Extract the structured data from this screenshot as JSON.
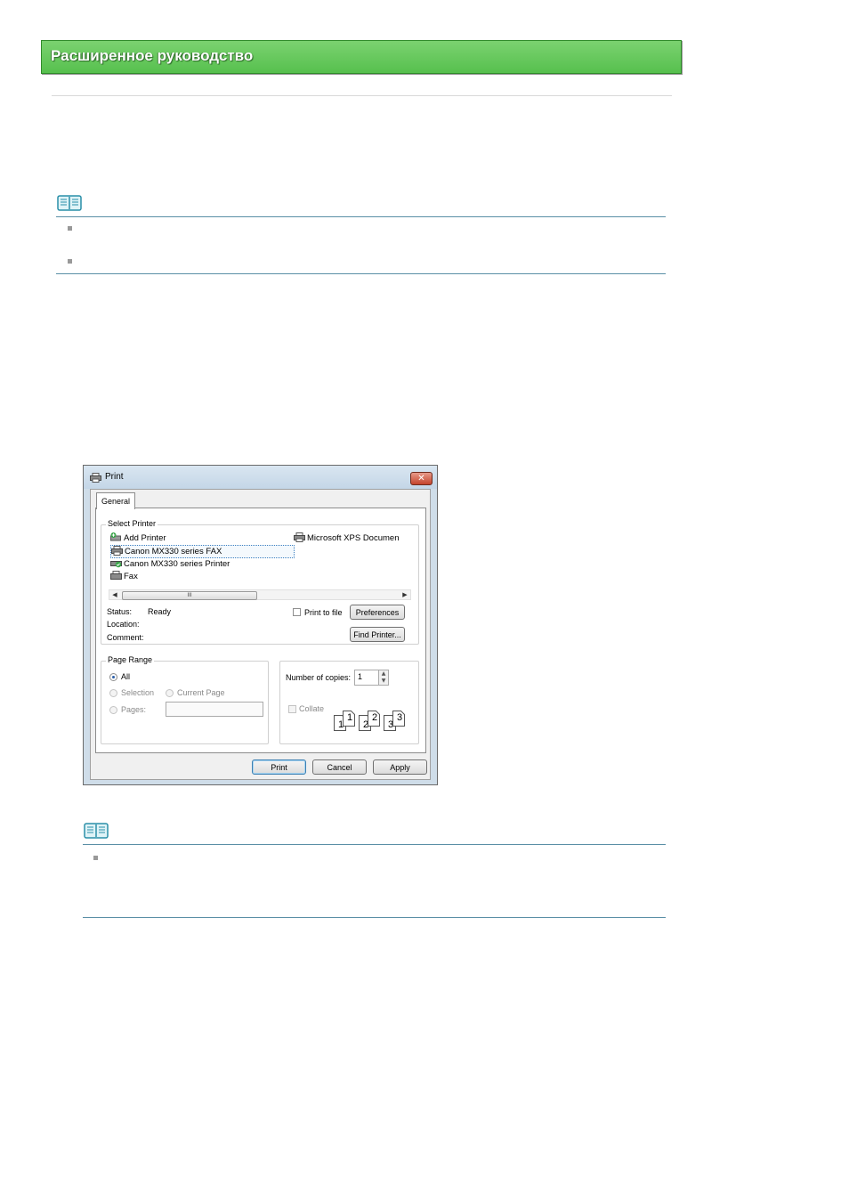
{
  "header": {
    "title": "Расширенное руководство"
  },
  "dialog": {
    "title": "Print",
    "close_label": "✕",
    "tab_general": "General",
    "select_printer": {
      "label": "Select Printer",
      "printers": [
        "Add Printer",
        "Canon MX330 series FAX",
        "Canon MX330 series Printer",
        "Fax",
        "Microsoft XPS Documen"
      ],
      "scroll_thumb": "III",
      "status_label": "Status:",
      "status_value": "Ready",
      "location_label": "Location:",
      "comment_label": "Comment:",
      "print_to_file": "Print to file",
      "preferences": "Preferences",
      "find_printer": "Find Printer..."
    },
    "page_range": {
      "label": "Page Range",
      "all": "All",
      "selection": "Selection",
      "current_page": "Current Page",
      "pages": "Pages:"
    },
    "copies": {
      "label": "Number of copies:",
      "value": "1",
      "collate": "Collate",
      "page_numbers": [
        "1",
        "1",
        "2",
        "2",
        "3",
        "3"
      ]
    },
    "buttons": {
      "print": "Print",
      "cancel": "Cancel",
      "apply": "Apply"
    }
  }
}
